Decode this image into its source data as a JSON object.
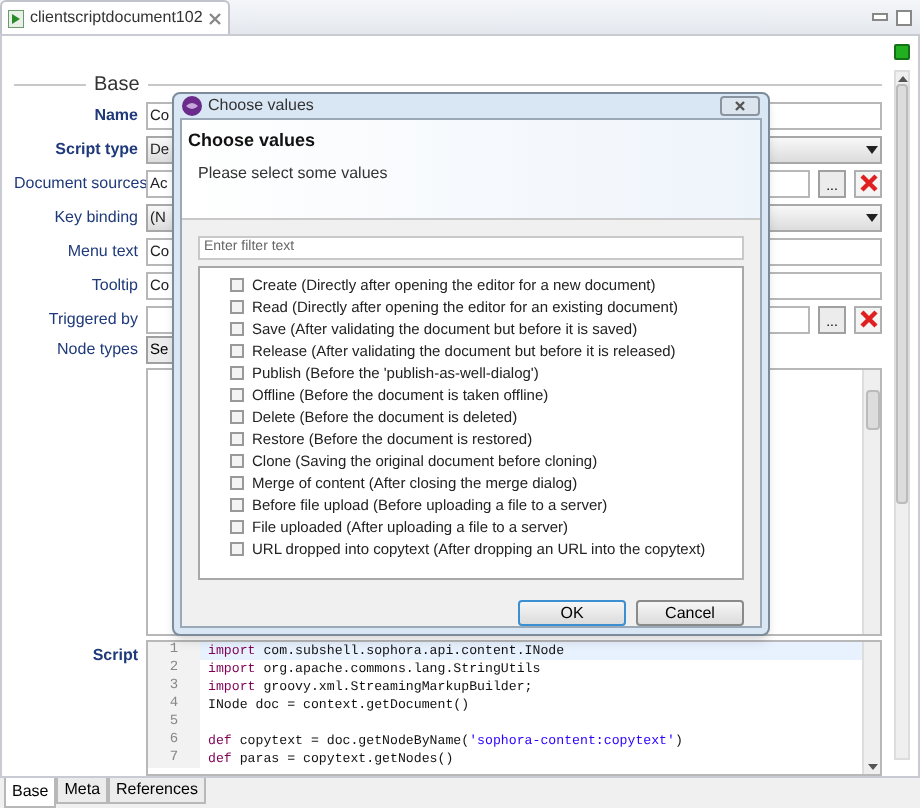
{
  "editor_tab": {
    "title": "clientscriptdocument102"
  },
  "section": {
    "title": "Base"
  },
  "fields": [
    {
      "label": "Name",
      "kind": "text",
      "required": true,
      "value": "Co"
    },
    {
      "label": "Script type",
      "kind": "select",
      "required": true,
      "value": "De"
    },
    {
      "label": "Document sources",
      "kind": "reference",
      "required": false,
      "value": "Ac",
      "browse": "..."
    },
    {
      "label": "Key binding",
      "kind": "select",
      "required": false,
      "value": "(N"
    },
    {
      "label": "Menu text",
      "kind": "text",
      "required": false,
      "value": "Co"
    },
    {
      "label": "Tooltip",
      "kind": "text",
      "required": false,
      "value": "Co"
    },
    {
      "label": "Triggered by",
      "kind": "reference",
      "required": false,
      "browse": "..."
    },
    {
      "label": "Node types",
      "kind": "list",
      "required": false,
      "button": "Se"
    }
  ],
  "script": {
    "label": "Script",
    "lines": [
      {
        "number": "1",
        "current": true,
        "tokens": [
          {
            "kind": "keyword",
            "text": "import"
          },
          {
            "kind": "plain",
            "text": " com.subshell.sophora.api.content.INode"
          }
        ]
      },
      {
        "number": "2",
        "current": false,
        "tokens": [
          {
            "kind": "keyword",
            "text": "import"
          },
          {
            "kind": "plain",
            "text": " org.apache.commons.lang.StringUtils"
          }
        ]
      },
      {
        "number": "3",
        "current": false,
        "tokens": [
          {
            "kind": "keyword",
            "text": "import"
          },
          {
            "kind": "plain",
            "text": " groovy.xml.StreamingMarkupBuilder;"
          }
        ]
      },
      {
        "number": "4",
        "current": false,
        "tokens": [
          {
            "kind": "plain",
            "text": "INode doc = context.getDocument()"
          }
        ]
      },
      {
        "number": "5",
        "current": false
      },
      {
        "number": "6",
        "current": false,
        "tokens": [
          {
            "kind": "keyword",
            "text": "def"
          },
          {
            "kind": "plain",
            "text": " copytext = doc.getNodeByName("
          },
          {
            "kind": "string",
            "text": "'sophora-content:copytext'"
          },
          {
            "kind": "plain",
            "text": ")"
          }
        ]
      },
      {
        "number": "7",
        "current": false,
        "tokens": [
          {
            "kind": "keyword",
            "text": "def"
          },
          {
            "kind": "plain",
            "text": " paras = copytext.getNodes()"
          }
        ]
      }
    ]
  },
  "bottom_tabs": [
    {
      "label": "Base",
      "selected": true
    },
    {
      "label": "Meta",
      "selected": false
    },
    {
      "label": "References",
      "selected": false
    }
  ],
  "dialog": {
    "title": "Choose values",
    "heading": "Choose values",
    "message": "Please select some values",
    "filter": {
      "placeholder": "Enter filter text"
    },
    "options": [
      {
        "label": "Create (Directly after opening the editor for a new document)",
        "checked": false
      },
      {
        "label": "Read (Directly after opening the editor for an existing document)",
        "checked": false
      },
      {
        "label": "Save (After validating the document but before it is saved)",
        "checked": false
      },
      {
        "label": "Release (After validating the document but before it is released)",
        "checked": false
      },
      {
        "label": "Publish (Before the 'publish-as-well-dialog')",
        "checked": false
      },
      {
        "label": "Offline (Before the document is taken offline)",
        "checked": false
      },
      {
        "label": "Delete (Before the document is deleted)",
        "checked": false
      },
      {
        "label": "Restore (Before the document is restored)",
        "checked": false
      },
      {
        "label": "Clone (Saving the original document before cloning)",
        "checked": false
      },
      {
        "label": "Merge of content (After closing the merge dialog)",
        "checked": false
      },
      {
        "label": "Before file upload (Before uploading a file to a server)",
        "checked": false
      },
      {
        "label": "File uploaded (After uploading a file to a server)",
        "checked": false
      },
      {
        "label": "URL dropped into copytext (After dropping an URL into the copytext)",
        "checked": false
      }
    ],
    "buttons": [
      {
        "label": "OK",
        "default": true
      },
      {
        "label": "Cancel",
        "default": false
      }
    ]
  }
}
